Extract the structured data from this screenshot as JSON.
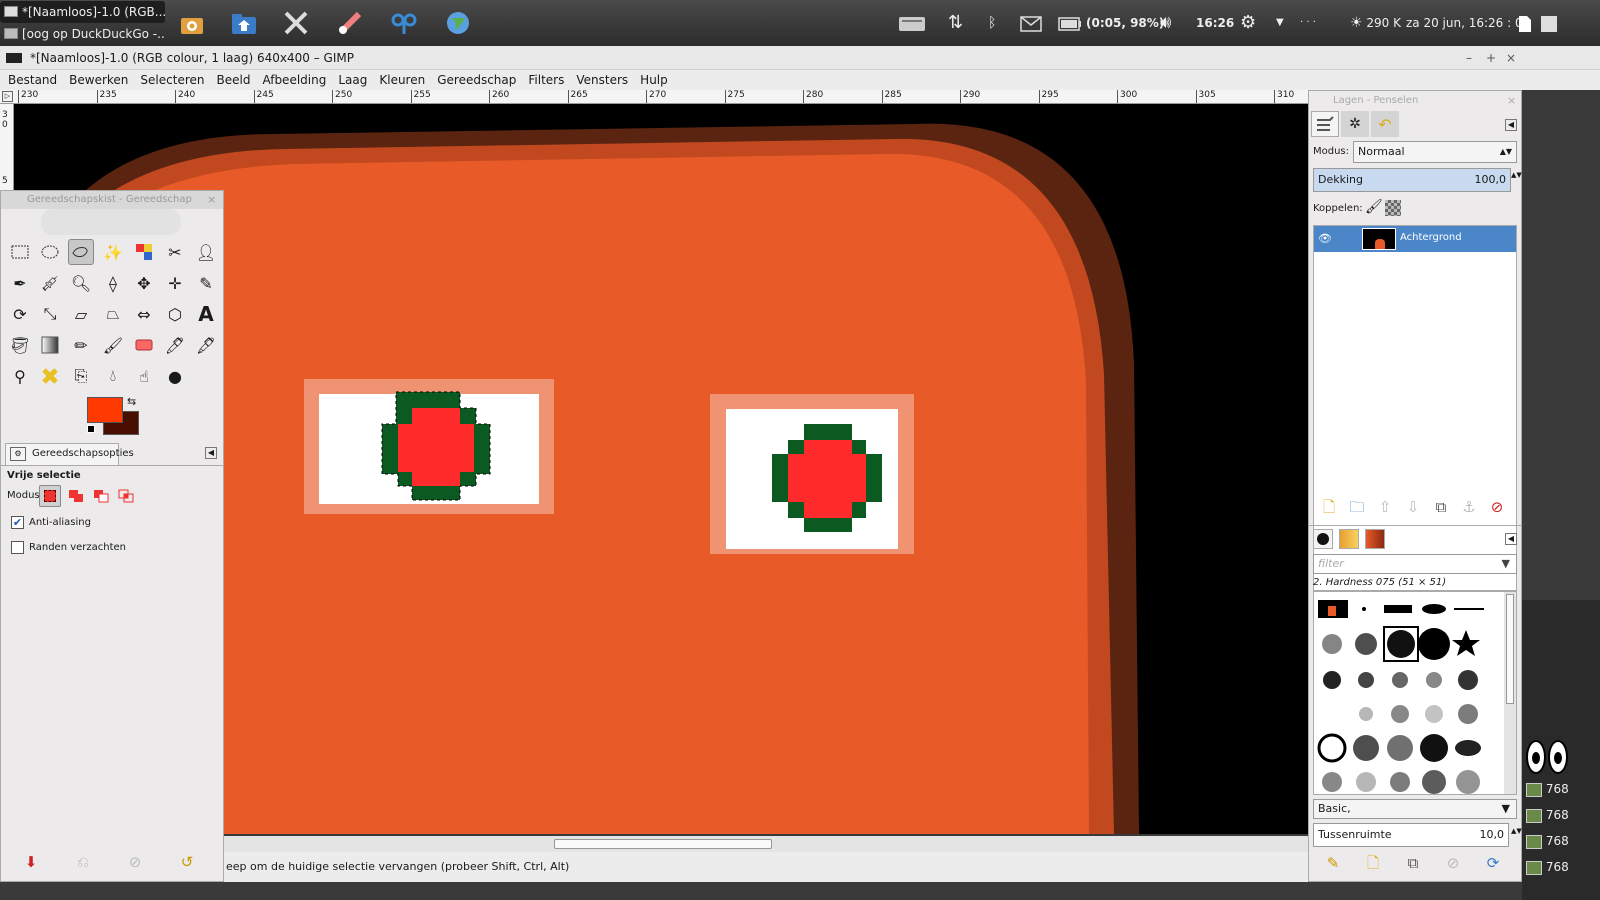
{
  "taskbar": {
    "tasks": [
      "*[Naamloos]-1.0 (RGB...",
      "[oog op DuckDuckGo -..."
    ],
    "clock": "16:26",
    "battery": "(0:05, 98%)",
    "weather": "290 K",
    "datetime": "za 20 jun, 16:26 : 04"
  },
  "window": {
    "title": "*[Naamloos]-1.0 (RGB colour, 1 laag) 640x400 – GIMP"
  },
  "menu": [
    "Bestand",
    "Bewerken",
    "Selecteren",
    "Beeld",
    "Afbeelding",
    "Laag",
    "Kleuren",
    "Gereedschap",
    "Filters",
    "Vensters",
    "Hulp"
  ],
  "ruler": {
    "ticks": [
      "230",
      "235",
      "240",
      "245",
      "250",
      "255",
      "260",
      "265",
      "270",
      "275",
      "280",
      "285",
      "290",
      "295",
      "300",
      "305",
      "310"
    ],
    "left_ticks": [
      "3",
      "0",
      "5"
    ]
  },
  "status": {
    "message": "eep om de huidige selectie vervangen (probeer Shift, Ctrl, Alt)"
  },
  "toolbox": {
    "title": "Gereedschapskist - Gereedschap",
    "fg_color": "#ff3a00",
    "bg_color": "#4a0e00",
    "options_tab": "Gereedschapsopties",
    "options_heading": "Vrije selectie",
    "mode_label": "Modus:",
    "antialias_label": "Anti-aliasing",
    "antialias_checked": true,
    "feather_label": "Randen verzachten",
    "feather_checked": false
  },
  "layers": {
    "title": "Lagen - Penselen",
    "mode_label": "Modus:",
    "mode_value": "Normaal",
    "opacity_label": "Dekking",
    "opacity_value": "100,0",
    "link_label": "Koppelen:",
    "layer_name": "Achtergrond"
  },
  "brushes": {
    "filter_placeholder": "filter",
    "selected_brush": "2. Hardness 075 (51 × 51)",
    "tag_value": "Basic,",
    "spacing_label": "Tussenruimte",
    "spacing_value": "10,0"
  },
  "desktop": {
    "side_labels": [
      "768",
      "768",
      "768",
      "768"
    ]
  },
  "colors": {
    "canvas_orange": "#e85a28",
    "pupil_red": "#ff2a2a",
    "iris_green": "#0b5a22",
    "layer_highlight": "#4a86c8"
  }
}
